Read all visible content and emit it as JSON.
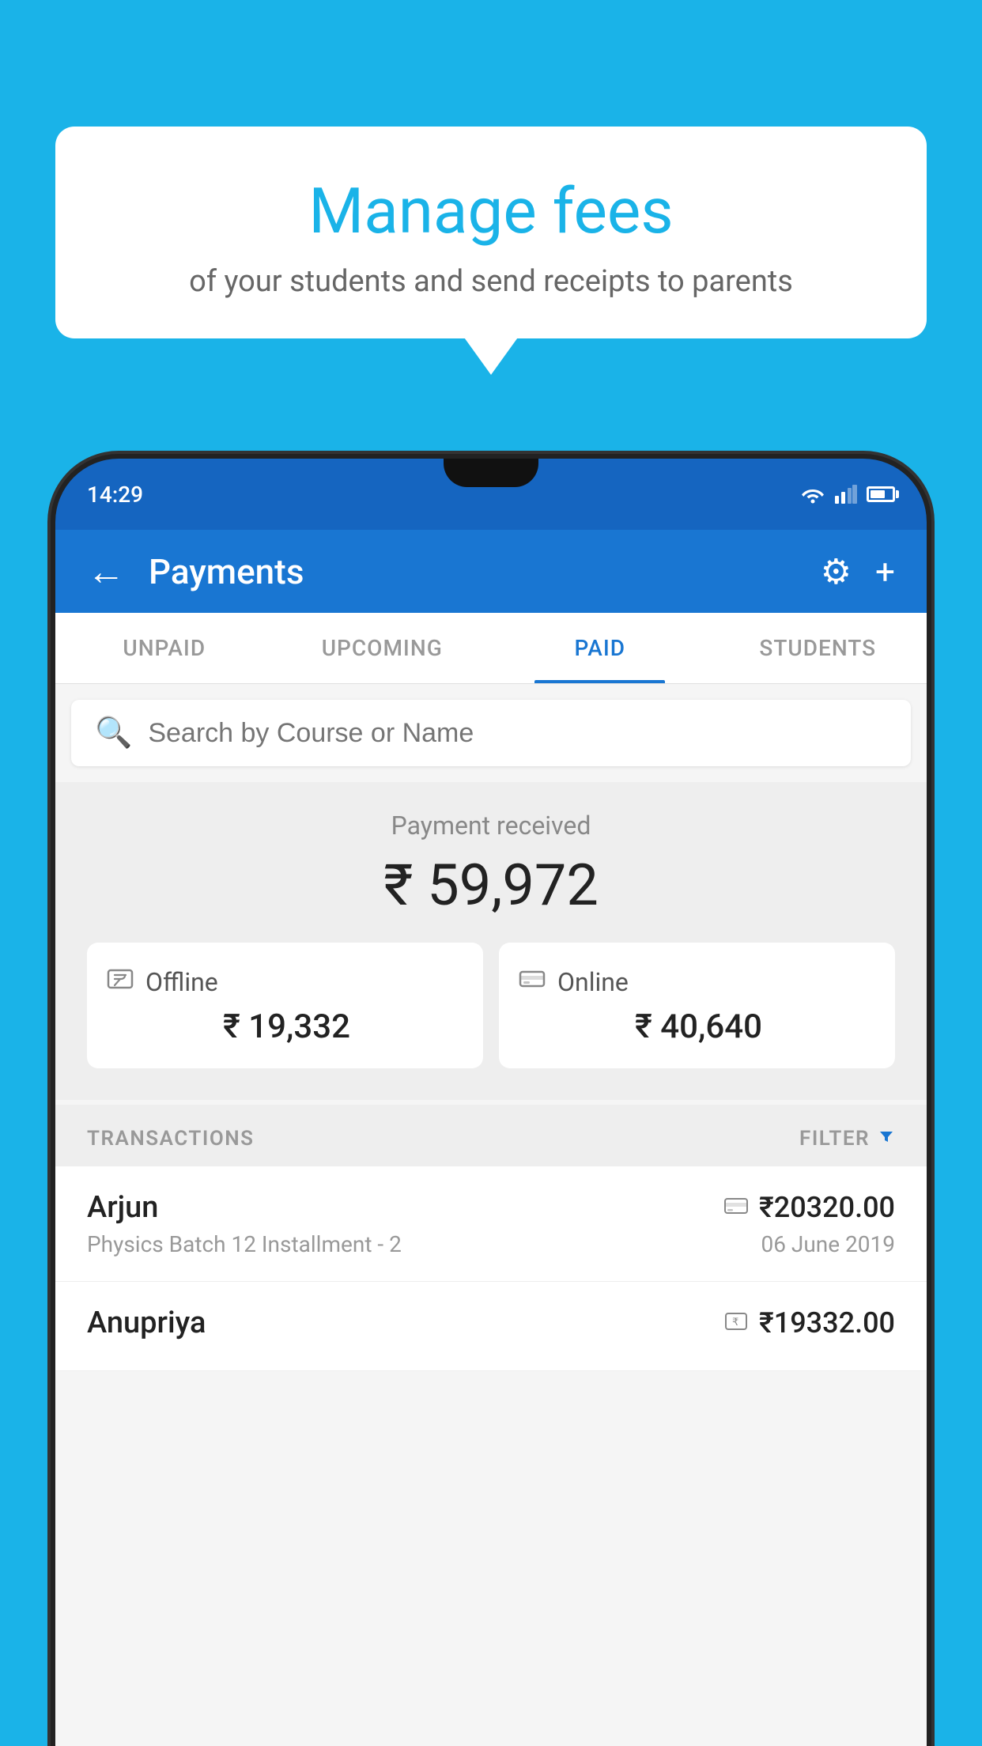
{
  "background": {
    "color": "#1ab3e8"
  },
  "speech_bubble": {
    "title": "Manage fees",
    "subtitle": "of your students and send receipts to parents"
  },
  "phone": {
    "status_bar": {
      "time": "14:29"
    },
    "header": {
      "title": "Payments",
      "back_icon": "←",
      "settings_icon": "⚙",
      "add_icon": "+"
    },
    "tabs": [
      {
        "label": "UNPAID",
        "active": false
      },
      {
        "label": "UPCOMING",
        "active": false
      },
      {
        "label": "PAID",
        "active": true
      },
      {
        "label": "STUDENTS",
        "active": false
      }
    ],
    "search": {
      "placeholder": "Search by Course or Name"
    },
    "payment_received": {
      "label": "Payment received",
      "total": "₹ 59,972",
      "offline_label": "Offline",
      "offline_amount": "₹ 19,332",
      "online_label": "Online",
      "online_amount": "₹ 40,640"
    },
    "transactions_header": {
      "label": "TRANSACTIONS",
      "filter_label": "FILTER"
    },
    "transactions": [
      {
        "name": "Arjun",
        "method_icon": "💳",
        "amount": "₹20320.00",
        "description": "Physics Batch 12 Installment - 2",
        "date": "06 June 2019"
      },
      {
        "name": "Anupriya",
        "method_icon": "🪙",
        "amount": "₹19332.00",
        "description": "",
        "date": ""
      }
    ]
  }
}
